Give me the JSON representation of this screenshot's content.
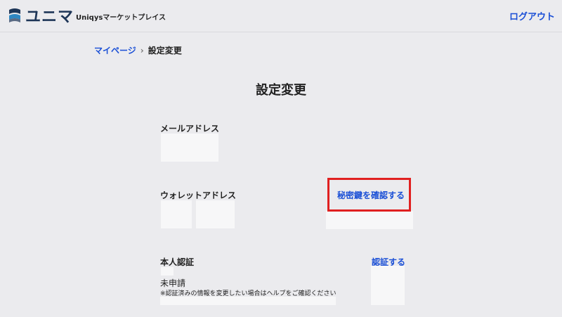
{
  "header": {
    "logo_text": "ユニマ",
    "marketplace_name": "Uniqysマーケットプレイス",
    "logout_label": "ログアウト",
    "brand_color": "#1d3557",
    "link_color": "#1a4fd6"
  },
  "breadcrumb": {
    "home_label": "マイページ",
    "separator": "›",
    "current_label": "設定変更"
  },
  "page": {
    "title": "設定変更"
  },
  "sections": {
    "email": {
      "label": "メールアドレス"
    },
    "wallet": {
      "label": "ウォレットアドレス",
      "action_label": "秘密鍵を確認する",
      "highlight_color": "#e02020"
    },
    "identity": {
      "label": "本人認証",
      "action_label": "認証する",
      "status": "未申請",
      "note": "※認証済みの情報を変更したい場合はヘルプをご確認ください"
    }
  }
}
